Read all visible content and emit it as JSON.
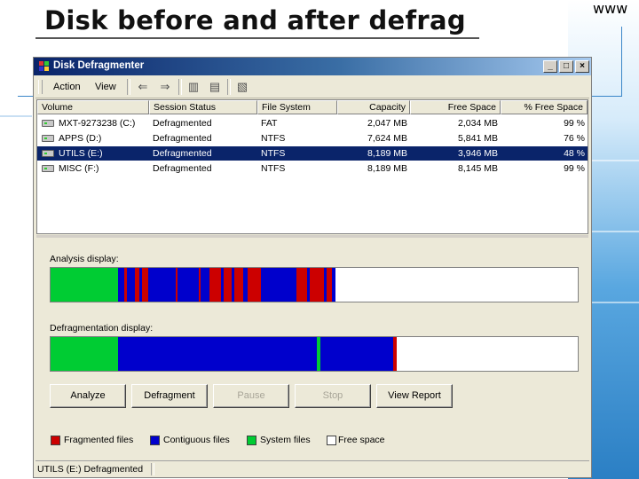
{
  "slide": {
    "title": "Disk before and after defrag"
  },
  "window": {
    "title": "Disk Defragmenter",
    "controls": {
      "minimize": "_",
      "maximize": "□",
      "close": "×"
    },
    "menu": [
      {
        "label": "Action"
      },
      {
        "label": "View"
      }
    ],
    "toolbar_icons": [
      "back-arrow-icon",
      "forward-arrow-icon",
      "folder-icon",
      "properties-icon",
      "help-icon"
    ]
  },
  "volumes": {
    "columns": [
      "Volume",
      "Session Status",
      "File System",
      "Capacity",
      "Free Space",
      "% Free Space"
    ],
    "rows": [
      {
        "volume": "MXT-9273238 (C:)",
        "status": "Defragmented",
        "fs": "FAT",
        "capacity": "2,047 MB",
        "free": "2,034 MB",
        "pct": "99 %",
        "selected": false
      },
      {
        "volume": "APPS (D:)",
        "status": "Defragmented",
        "fs": "NTFS",
        "capacity": "7,624 MB",
        "free": "5,841 MB",
        "pct": "76 %",
        "selected": false
      },
      {
        "volume": "UTILS (E:)",
        "status": "Defragmented",
        "fs": "NTFS",
        "capacity": "8,189 MB",
        "free": "3,946 MB",
        "pct": "48 %",
        "selected": true
      },
      {
        "volume": "MISC (F:)",
        "status": "Defragmented",
        "fs": "NTFS",
        "capacity": "8,189 MB",
        "free": "8,145 MB",
        "pct": "99 %",
        "selected": false
      }
    ]
  },
  "analysis": {
    "label": "Analysis display:",
    "segments": [
      {
        "type": "system",
        "pct": 12.8
      },
      {
        "type": "contiguous",
        "pct": 1.2
      },
      {
        "type": "fragmented",
        "pct": 0.5
      },
      {
        "type": "contiguous",
        "pct": 1.5
      },
      {
        "type": "fragmented",
        "pct": 0.8
      },
      {
        "type": "contiguous",
        "pct": 0.6
      },
      {
        "type": "fragmented",
        "pct": 1.2
      },
      {
        "type": "contiguous",
        "pct": 5.2
      },
      {
        "type": "fragmented",
        "pct": 0.3
      },
      {
        "type": "contiguous",
        "pct": 4.0
      },
      {
        "type": "fragmented",
        "pct": 0.4
      },
      {
        "type": "contiguous",
        "pct": 1.6
      },
      {
        "type": "fragmented",
        "pct": 2.2
      },
      {
        "type": "contiguous",
        "pct": 0.6
      },
      {
        "type": "fragmented",
        "pct": 1.4
      },
      {
        "type": "contiguous",
        "pct": 0.5
      },
      {
        "type": "fragmented",
        "pct": 1.8
      },
      {
        "type": "contiguous",
        "pct": 0.7
      },
      {
        "type": "fragmented",
        "pct": 2.6
      },
      {
        "type": "contiguous",
        "pct": 6.8
      },
      {
        "type": "fragmented",
        "pct": 1.9
      },
      {
        "type": "contiguous",
        "pct": 0.5
      },
      {
        "type": "fragmented",
        "pct": 2.8
      },
      {
        "type": "contiguous",
        "pct": 0.4
      },
      {
        "type": "fragmented",
        "pct": 1.0
      },
      {
        "type": "contiguous",
        "pct": 0.8
      },
      {
        "type": "free",
        "pct": 35.9
      }
    ]
  },
  "defrag": {
    "label": "Defragmentation display:",
    "segments": [
      {
        "type": "system",
        "pct": 12.8
      },
      {
        "type": "contiguous",
        "pct": 37.7
      },
      {
        "type": "system",
        "pct": 0.7
      },
      {
        "type": "contiguous",
        "pct": 13.8
      },
      {
        "type": "fragmented",
        "pct": 0.6
      },
      {
        "type": "free",
        "pct": 34.4
      }
    ]
  },
  "colors": {
    "fragmented": "#cc0000",
    "contiguous": "#0000cc",
    "system": "#00cc33",
    "free": "#ffffff"
  },
  "buttons": [
    {
      "label": "Analyze",
      "enabled": true
    },
    {
      "label": "Defragment",
      "enabled": true
    },
    {
      "label": "Pause",
      "enabled": false
    },
    {
      "label": "Stop",
      "enabled": false
    },
    {
      "label": "View Report",
      "enabled": true
    }
  ],
  "legend": [
    {
      "label": "Fragmented files",
      "type": "fragmented"
    },
    {
      "label": "Contiguous files",
      "type": "contiguous"
    },
    {
      "label": "System files",
      "type": "system"
    },
    {
      "label": "Free space",
      "type": "free"
    }
  ],
  "status": {
    "text": "UTILS (E:) Defragmented"
  }
}
